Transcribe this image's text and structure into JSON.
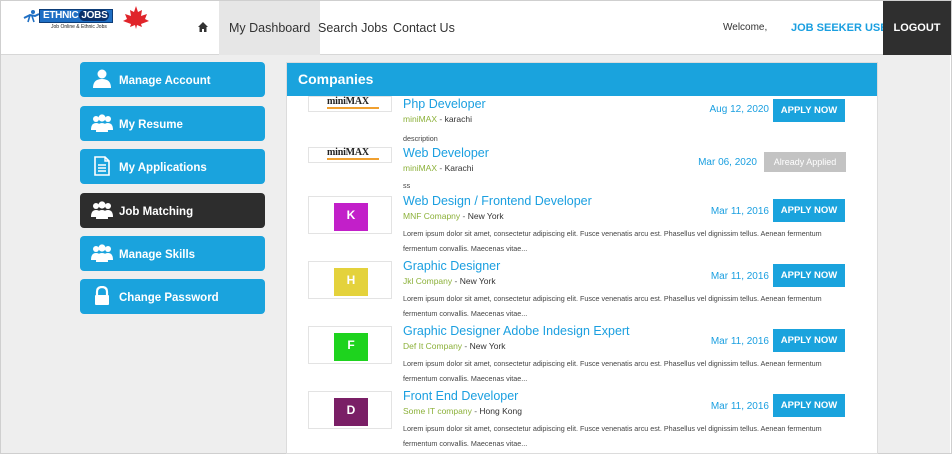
{
  "brand": {
    "name_part1": "ETHNIC",
    "name_part2": "JOBS",
    "tagline": "Job Online & Ethnic Jobs"
  },
  "nav": {
    "home_icon": "home-icon",
    "items": [
      "My Dashboard",
      "Search Jobs",
      "Contact Us"
    ],
    "active": "My Dashboard",
    "welcome": "Welcome,",
    "user": "JOB SEEKER USER!",
    "logout": "LOGOUT"
  },
  "sidebar": {
    "items": [
      {
        "label": "Manage Account",
        "icon": "user-icon",
        "active": false
      },
      {
        "label": "My Resume",
        "icon": "users-icon",
        "active": false
      },
      {
        "label": "My Applications",
        "icon": "document-icon",
        "active": false
      },
      {
        "label": "Job Matching",
        "icon": "users-icon",
        "active": true
      },
      {
        "label": "Manage Skills",
        "icon": "users-icon",
        "active": false
      },
      {
        "label": "Change Password",
        "icon": "lock-icon",
        "active": false
      }
    ]
  },
  "panel": {
    "title": "Companies"
  },
  "jobs": [
    {
      "title": "Php Developer",
      "company": "miniMAX",
      "location": "karachi",
      "date": "Aug 12, 2020",
      "action": "APPLY NOW",
      "applied": false,
      "desc": "description",
      "logo_text": "miniMAX",
      "logo_color": ""
    },
    {
      "title": "Web Developer",
      "company": "miniMAX",
      "location": "Karachi",
      "date": "Mar 06, 2020",
      "action": "Already Applied",
      "applied": true,
      "desc": "ss",
      "logo_text": "miniMAX",
      "logo_color": ""
    },
    {
      "title": "Web Design / Frontend Developer",
      "company": "MNF Comapny",
      "location": "New York",
      "date": "Mar 11, 2016",
      "action": "APPLY NOW",
      "applied": false,
      "desc": "Lorem ipsum dolor sit amet, consectetur adipiscing elit. Fusce venenatis arcu est. Phasellus vel dignissim tellus. Aenean fermentum fermentum convallis. Maecenas vitae...",
      "logo_text": "K",
      "logo_color": "#c21fc9"
    },
    {
      "title": "Graphic Designer",
      "company": "Jkl Company",
      "location": "New York",
      "date": "Mar 11, 2016",
      "action": "APPLY NOW",
      "applied": false,
      "desc": "Lorem ipsum dolor sit amet, consectetur adipiscing elit. Fusce venenatis arcu est. Phasellus vel dignissim tellus. Aenean fermentum fermentum convallis. Maecenas vitae...",
      "logo_text": "H",
      "logo_color": "#e4d23c"
    },
    {
      "title": "Graphic Designer Adobe Indesign Expert",
      "company": "Def It Company",
      "location": "New York",
      "date": "Mar 11, 2016",
      "action": "APPLY NOW",
      "applied": false,
      "desc": "Lorem ipsum dolor sit amet, consectetur adipiscing elit. Fusce venenatis arcu est. Phasellus vel dignissim tellus. Aenean fermentum fermentum convallis. Maecenas vitae...",
      "logo_text": "F",
      "logo_color": "#1ed31e"
    },
    {
      "title": "Front End Developer",
      "company": "Some IT company",
      "location": "Hong Kong",
      "date": "Mar 11, 2016",
      "action": "APPLY NOW",
      "applied": false,
      "desc": "Lorem ipsum dolor sit amet, consectetur adipiscing elit. Fusce venenatis arcu est. Phasellus vel dignissim tellus. Aenean fermentum fermentum convallis. Maecenas vitae...",
      "logo_text": "D",
      "logo_color": "#7a1f66"
    }
  ],
  "colors": {
    "accent": "#1aa3dd",
    "dark": "#2d2d2d",
    "company": "#8cb13a"
  }
}
